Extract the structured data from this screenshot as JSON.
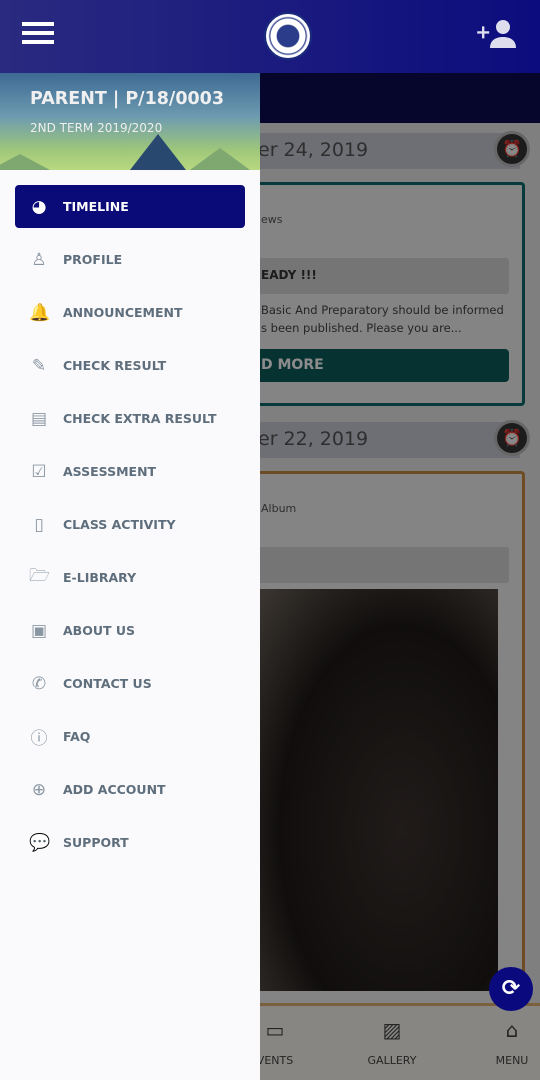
{
  "header": {
    "menu_icon": "hamburger-icon",
    "logo": "school-crest",
    "add_user_icon": "add-user-icon"
  },
  "drawer": {
    "title": "PARENT | P/18/0003",
    "term": "2ND TERM 2019/2020",
    "items": [
      {
        "label": "TIMELINE",
        "icon": "dashboard-icon",
        "glyph": "◕",
        "active": true
      },
      {
        "label": "PROFILE",
        "icon": "person-pin-icon",
        "glyph": "♙"
      },
      {
        "label": "ANNOUNCEMENT",
        "icon": "bell-icon",
        "glyph": "🔔"
      },
      {
        "label": "CHECK RESULT",
        "icon": "edit-icon",
        "glyph": "✎"
      },
      {
        "label": "CHECK EXTRA RESULT",
        "icon": "newspaper-icon",
        "glyph": "▤"
      },
      {
        "label": "ASSESSMENT",
        "icon": "check-square-icon",
        "glyph": "☑"
      },
      {
        "label": "CLASS ACTIVITY",
        "icon": "file-icon",
        "glyph": "▯"
      },
      {
        "label": "E-LIBRARY",
        "icon": "folder-open-icon",
        "glyph": "🗁"
      },
      {
        "label": "ABOUT US",
        "icon": "id-card-icon",
        "glyph": "▣"
      },
      {
        "label": "CONTACT US",
        "icon": "phone-icon",
        "glyph": "✆"
      },
      {
        "label": "FAQ",
        "icon": "info-icon",
        "glyph": "ⓘ"
      },
      {
        "label": "ADD ACCOUNT",
        "icon": "plus-circle-icon",
        "glyph": "⊕"
      },
      {
        "label": "SUPPORT",
        "icon": "comments-icon",
        "glyph": "💬"
      }
    ]
  },
  "timeline": {
    "posts": [
      {
        "date": "er 24, 2019",
        "category": "ews",
        "title": "EADY !!!",
        "desc": "Basic And Preparatory should be informed s been published. Please you are...",
        "button": "D MORE",
        "border": "#0d6b6b"
      },
      {
        "date": "er 22, 2019",
        "category": "Album",
        "border": "#c88a40"
      }
    ]
  },
  "bottom_nav": [
    {
      "label": "VENTS",
      "icon": "calendar-icon"
    },
    {
      "label": "GALLERY",
      "icon": "image-icon"
    },
    {
      "label": "MENU",
      "icon": "home-icon"
    }
  ],
  "refresh_icon": "refresh-icon",
  "colors": {
    "primary": "#0a0a78",
    "teal": "#0c5b5b"
  }
}
